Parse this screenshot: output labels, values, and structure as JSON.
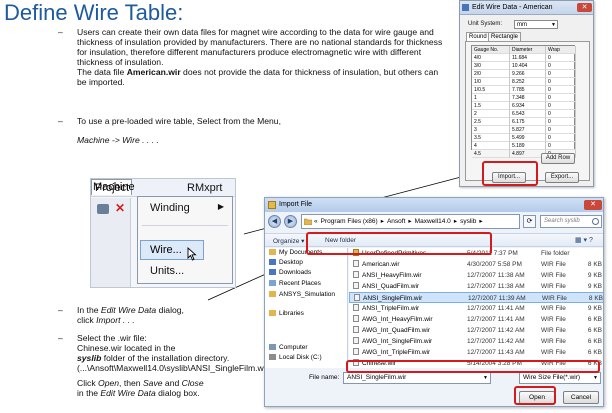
{
  "slide": {
    "title": "Define Wire Table:",
    "bullet1": {
      "dash": "–",
      "p1": "Users can create their own data files for magnet wire according to the data for wire gauge and thickness of insulation provided by manufacturers. There are no national standards for thickness for insulation, therefore different manufacturers produce electromagnetic wire with different thickness of insulation.",
      "p2_pre": "The data file ",
      "p2_bold": "American.wir",
      "p2_post": " does not provide the data for thickness of insulation, but others can be imported."
    },
    "bullet2": {
      "dash": "–",
      "line1": "To use a pre-loaded wire table, Select from the Menu,",
      "line2": "Machine -> Wire . . . ."
    },
    "bullet3": {
      "dash": "–",
      "pre": "In the ",
      "italic": "Edit Wire Data",
      "post": " dialog,",
      "line2_pre": "click ",
      "line2_italic": "Import . . ."
    },
    "bullet4": {
      "dash": "–",
      "line1": "Select the .wir file:",
      "line2": "Chinese.wir located in the",
      "line3_bold": "syslib",
      "line3_post": " folder of the installation directory.",
      "line4": "(...\\Ansoft\\Maxwell14.0\\syslib\\ANSI_SingleFilm.wir)",
      "line5_pre": "Click ",
      "line5_open": "Open",
      "line5_mid": ", then ",
      "line5_save": "Save",
      "line5_and": " and ",
      "line5_close": "Close",
      "line6_pre": "in the ",
      "line6_italic": "Edit Wire Data",
      "line6_post": " dialog box."
    }
  },
  "menu": {
    "bar": [
      "Project",
      "Machine",
      "RMxprt"
    ],
    "items": [
      "Winding",
      "Wire...",
      "Units..."
    ]
  },
  "edit_wire": {
    "title": "Edit Wire Data - American",
    "unit_label": "Unit System:",
    "unit_value": "mm",
    "tabs": [
      "Round",
      "Rectangle"
    ],
    "columns": [
      "Gauge No.",
      "Diameter",
      "Wrap"
    ],
    "rows": [
      [
        "4/0",
        "11.684",
        "0"
      ],
      [
        "3/0",
        "10.404",
        "0"
      ],
      [
        "2/0",
        "9.266",
        "0"
      ],
      [
        "1/0",
        "8.252",
        "0"
      ],
      [
        "1/0.5",
        "7.785",
        "0"
      ],
      [
        "1",
        "7.348",
        "0"
      ],
      [
        "1.5",
        "6.934",
        "0"
      ],
      [
        "2",
        "6.543",
        "0"
      ],
      [
        "2.5",
        "6.175",
        "0"
      ],
      [
        "3",
        "5.827",
        "0"
      ],
      [
        "3.5",
        "5.499",
        "0"
      ],
      [
        "4",
        "5.189",
        "0"
      ],
      [
        "4.5",
        "4.897",
        "0"
      ]
    ],
    "add_row": "Add Row",
    "import": "Import...",
    "export": "Export..."
  },
  "import_file": {
    "title": "Import File",
    "breadcrumb": [
      "«",
      "Program Files (x86)",
      "▸",
      "Ansoft",
      "▸",
      "Maxwell14.0",
      "▸",
      "syslib",
      "▸"
    ],
    "search_placeholder": "Search syslib",
    "organize": "Organize ▾",
    "new_folder": "New folder",
    "nav": [
      {
        "label": "My Documents",
        "color": "#e2b552"
      },
      {
        "label": "Desktop",
        "color": "#4a78c0"
      },
      {
        "label": "Downloads",
        "color": "#4a78c0"
      },
      {
        "label": "Recent Places",
        "color": "#7fa3cf"
      },
      {
        "label": "ANSYS_Simulation",
        "color": "#e2b552"
      },
      {
        "label": "",
        "color": ""
      },
      {
        "label": "Libraries",
        "color": "#e2b552"
      },
      {
        "label": "",
        "color": ""
      },
      {
        "label": "Computer",
        "color": "#7f97b7"
      },
      {
        "label": "Local Disk (C:)",
        "color": "#8c8c8c"
      }
    ],
    "files": [
      {
        "name": "UserDefinedPrimitives",
        "date": "5/4/2011 7:37 PM",
        "type": "File folder",
        "size": "",
        "folder": true
      },
      {
        "name": "American.wir",
        "date": "4/30/2007 5:58 PM",
        "type": "WIR File",
        "size": "8 KB"
      },
      {
        "name": "ANSI_HeavyFilm.wir",
        "date": "12/7/2007 11:38 AM",
        "type": "WIR File",
        "size": "9 KB"
      },
      {
        "name": "ANSI_QuadFilm.wir",
        "date": "12/7/2007 11:38 AM",
        "type": "WIR File",
        "size": "9 KB"
      },
      {
        "name": "ANSI_SingleFilm.wir",
        "date": "12/7/2007 11:39 AM",
        "type": "WIR File",
        "size": "8 KB",
        "selected": true
      },
      {
        "name": "ANSI_TripleFilm.wir",
        "date": "12/7/2007 11:41 AM",
        "type": "WIR File",
        "size": "9 KB"
      },
      {
        "name": "AWG_Int_HeavyFilm.wir",
        "date": "12/7/2007 11:41 AM",
        "type": "WIR File",
        "size": "6 KB"
      },
      {
        "name": "AWG_Int_QuadFilm.wir",
        "date": "12/7/2007 11:42 AM",
        "type": "WIR File",
        "size": "6 KB"
      },
      {
        "name": "AWG_Int_SingleFilm.wir",
        "date": "12/7/2007 11:42 AM",
        "type": "WIR File",
        "size": "6 KB"
      },
      {
        "name": "AWG_Int_TripleFilm.wir",
        "date": "12/7/2007 11:43 AM",
        "type": "WIR File",
        "size": "6 KB"
      },
      {
        "name": "Chinese.wir",
        "date": "5/14/2004 3:28 PM",
        "type": "WIR File",
        "size": "6 KB"
      }
    ],
    "filename_label": "File name:",
    "filename_value": "ANSI_SingleFilm.wir",
    "filetype_value": "Wire Size File(*.wir)",
    "open": "Open",
    "cancel": "Cancel"
  },
  "colors": {
    "title": "#1e5aa0",
    "highlight": "#d41a1a"
  }
}
